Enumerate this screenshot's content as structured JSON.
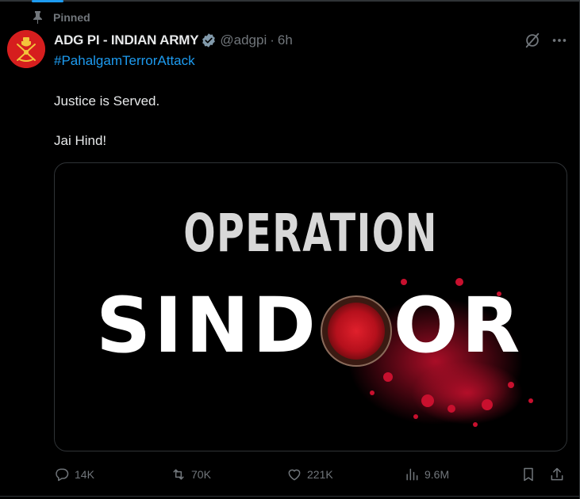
{
  "pinned_label": "Pinned",
  "post": {
    "author_name": "ADG PI - INDIAN ARMY",
    "handle": "@adgpi",
    "separator": "·",
    "time": "6h",
    "hashtag": "#PahalgamTerrorAttack",
    "text_lines": [
      "Justice is Served.",
      "Jai Hind!"
    ],
    "media": {
      "line1": "OPERATION",
      "line2_part1": "SIND",
      "line2_part2": "OR"
    }
  },
  "actions": {
    "replies": "14K",
    "reposts": "70K",
    "likes": "221K",
    "views": "9.6M"
  },
  "icons": {
    "pin": "pin-icon",
    "verified": "verified-badge-icon",
    "grok": "grok-icon",
    "more": "more-icon",
    "reply": "reply-icon",
    "repost": "repost-icon",
    "like": "heart-icon",
    "views": "views-icon",
    "bookmark": "bookmark-icon",
    "share": "share-icon"
  },
  "colors": {
    "background": "#000000",
    "text": "#e7e9ea",
    "muted": "#71767b",
    "link": "#1d9bf0",
    "verified": "#829aab",
    "avatar": "#d61e1e",
    "sindoor_red": "#c8102e"
  }
}
